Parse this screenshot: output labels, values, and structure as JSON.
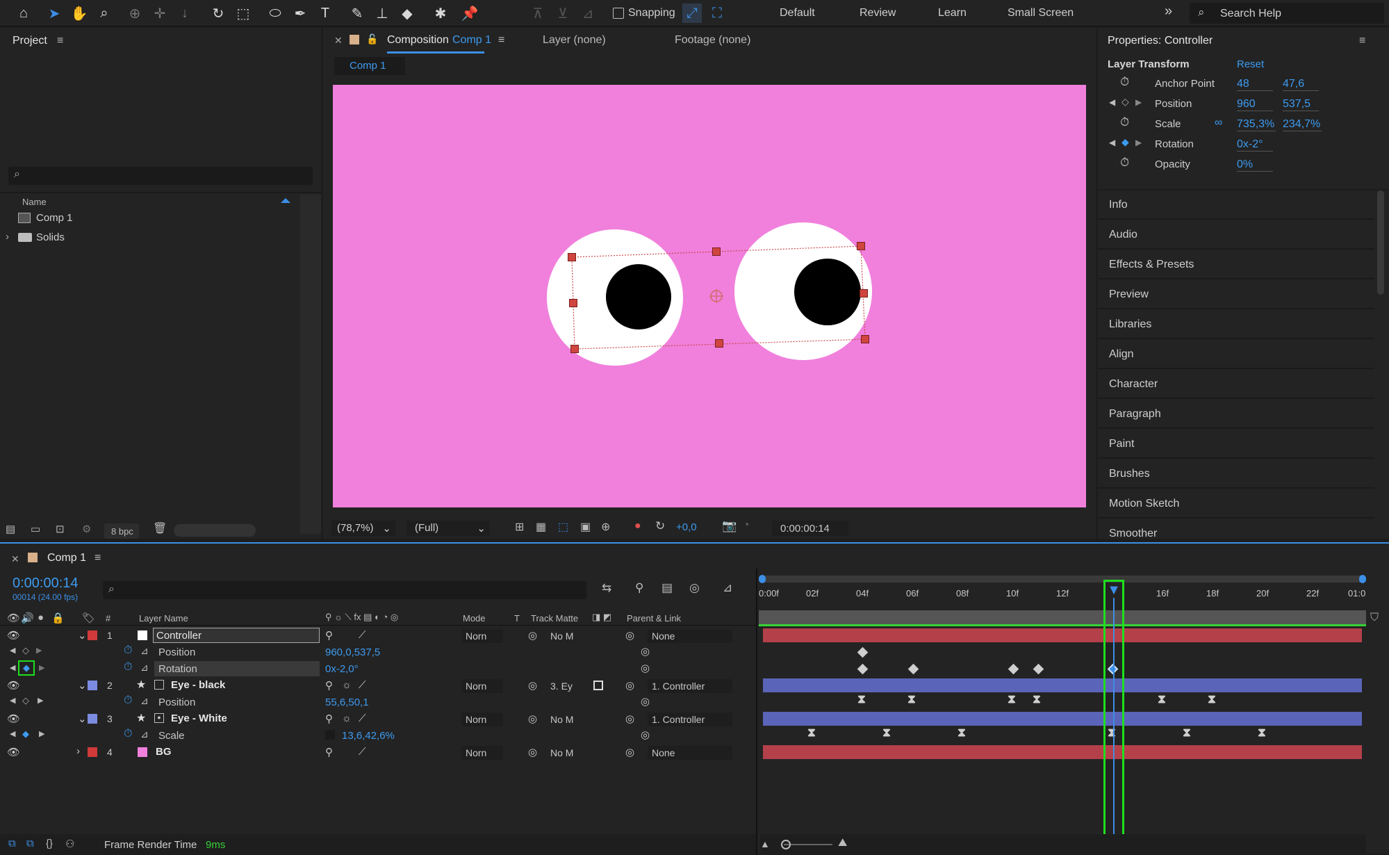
{
  "toolbar": {
    "snapping_label": "Snapping",
    "workspaces": [
      "Default",
      "Review",
      "Learn",
      "Small Screen"
    ],
    "more": "»",
    "search_placeholder": "Search Help"
  },
  "project": {
    "title": "Project",
    "column_name": "Name",
    "items": [
      {
        "name": "Comp 1"
      },
      {
        "name": "Solids"
      }
    ],
    "bpc": "8 bpc"
  },
  "comp_panel": {
    "tab_prefix": "Composition",
    "tab_comp": "Comp 1",
    "layer_tab": "Layer (none)",
    "footage_tab": "Footage (none)",
    "subtab": "Comp 1",
    "zoom": "(78,7%)",
    "resolution": "(Full)",
    "exposure": "+0,0",
    "timecode": "0:00:00:14",
    "bg_color": "#f080dc"
  },
  "properties": {
    "title": "Properties: Controller",
    "section": "Layer Transform",
    "reset": "Reset",
    "rows": [
      {
        "label": "Anchor Point",
        "v1": "48",
        "v2": "47,6"
      },
      {
        "label": "Position",
        "v1": "960",
        "v2": "537,5"
      },
      {
        "label": "Scale",
        "v1": "735,3%",
        "v2": "234,7%"
      },
      {
        "label": "Rotation",
        "v1": "0x-2°",
        "v2": ""
      },
      {
        "label": "Opacity",
        "v1": "0%",
        "v2": ""
      }
    ]
  },
  "right_panels": [
    "Info",
    "Audio",
    "Effects & Presets",
    "Preview",
    "Libraries",
    "Align",
    "Character",
    "Paragraph",
    "Paint",
    "Brushes",
    "Motion Sketch",
    "Smoother"
  ],
  "timeline": {
    "tab": "Comp 1",
    "timecode": "0:00:00:14",
    "frames": "00014 (24.00 fps)",
    "headers": {
      "num": "#",
      "layer_name": "Layer Name",
      "mode": "Mode",
      "t": "T",
      "track_matte": "Track Matte",
      "parent": "Parent & Link"
    },
    "ruler": [
      "0:00f",
      "02f",
      "04f",
      "06f",
      "08f",
      "10f",
      "12f",
      "",
      "16f",
      "18f",
      "20f",
      "22f",
      "01:0"
    ],
    "rows": [
      {
        "num": "1",
        "name": "Controller",
        "color": "#d03a3a",
        "mode": "Norn",
        "matte": "No M",
        "parent": "None",
        "type": "layer"
      },
      {
        "name": "Position",
        "value": "960,0,537,5",
        "type": "prop"
      },
      {
        "name": "Rotation",
        "value": "0x-2,0°",
        "type": "prop"
      },
      {
        "num": "2",
        "name": "Eye - black",
        "color": "#7b8ce0",
        "mode": "Norn",
        "matte": "3. Ey",
        "parent": "1. Controller",
        "type": "layer"
      },
      {
        "name": "Position",
        "value": "55,6,50,1",
        "type": "prop"
      },
      {
        "num": "3",
        "name": "Eye - White",
        "color": "#7b8ce0",
        "mode": "Norn",
        "matte": "No M",
        "parent": "1. Controller",
        "type": "layer"
      },
      {
        "name": "Scale",
        "value": "13,6,42,6%",
        "type": "prop"
      },
      {
        "num": "4",
        "name": "BG",
        "color": "#f080dc",
        "mode": "Norn",
        "matte": "No M",
        "parent": "None",
        "type": "layer"
      }
    ],
    "footer_label": "Frame Render Time",
    "footer_value": "9ms"
  }
}
